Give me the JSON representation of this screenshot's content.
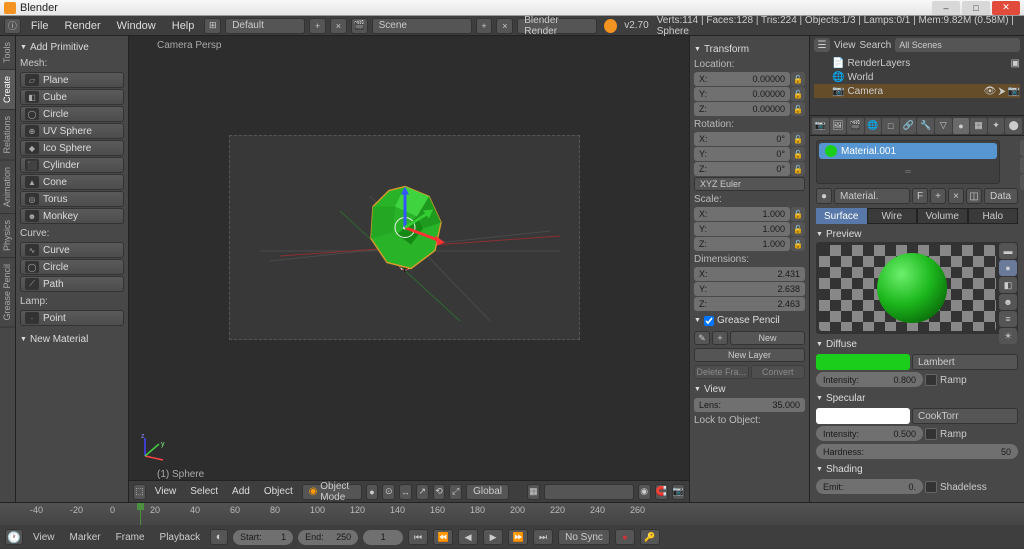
{
  "window": {
    "title": "Blender"
  },
  "winbtn": {
    "min": "–",
    "max": "□",
    "close": "✕"
  },
  "topmenu": {
    "items": [
      "File",
      "Render",
      "Window",
      "Help"
    ],
    "layout": "Default",
    "scene": "Scene",
    "engine": "Blender Render",
    "version": "v2.70",
    "stats": "Verts:114 | Faces:128 | Tris:224 | Objects:1/3 | Lamps:0/1 | Mem:9.82M (0.58M) | Sphere"
  },
  "leftTabs": [
    "Tools",
    "Create",
    "Relations",
    "Animation",
    "Physics",
    "Grease Pencil"
  ],
  "toolshelf": {
    "header": "Add Primitive",
    "mesh_label": "Mesh:",
    "mesh": [
      "Plane",
      "Cube",
      "Circle",
      "UV Sphere",
      "Ico Sphere",
      "Cylinder",
      "Cone",
      "Torus",
      "Monkey"
    ],
    "curve_label": "Curve:",
    "curve": [
      "Curve",
      "Circle",
      "Path"
    ],
    "lamp_label": "Lamp:",
    "lamp": [
      "Point"
    ],
    "op_header": "New Material"
  },
  "viewport": {
    "view_label": "Camera Persp",
    "obj_label": "(1) Sphere",
    "bottom": {
      "menus": [
        "View",
        "Select",
        "Add",
        "Object"
      ],
      "mode": "Object Mode",
      "orient": "Global"
    }
  },
  "npanel": {
    "transform": "Transform",
    "loc_label": "Location:",
    "loc": [
      {
        "a": "X:",
        "v": "0.00000"
      },
      {
        "a": "Y:",
        "v": "0.00000"
      },
      {
        "a": "Z:",
        "v": "0.00000"
      }
    ],
    "rot_label": "Rotation:",
    "rot": [
      {
        "a": "X:",
        "v": "0°"
      },
      {
        "a": "Y:",
        "v": "0°"
      },
      {
        "a": "Z:",
        "v": "0°"
      }
    ],
    "rot_mode": "XYZ Euler",
    "scale_label": "Scale:",
    "scale": [
      {
        "a": "X:",
        "v": "1.000"
      },
      {
        "a": "Y:",
        "v": "1.000"
      },
      {
        "a": "Z:",
        "v": "1.000"
      }
    ],
    "dim_label": "Dimensions:",
    "dim": [
      {
        "a": "X:",
        "v": "2.431"
      },
      {
        "a": "Y:",
        "v": "2.638"
      },
      {
        "a": "Z:",
        "v": "2.463"
      }
    ],
    "gp_header": "Grease Pencil",
    "gp_new": "New",
    "gp_newlayer": "New Layer",
    "gp_delete": "Delete Fra...",
    "gp_convert": "Convert",
    "view_header": "View",
    "lens_label": "Lens:",
    "lens_val": "35.000",
    "lock_label": "Lock to Object:"
  },
  "outliner": {
    "menus": [
      "View",
      "Search"
    ],
    "filter": "All Scenes",
    "items": [
      {
        "icon": "📄",
        "name": "RenderLayers"
      },
      {
        "icon": "🌐",
        "name": "World"
      },
      {
        "icon": "📷",
        "name": "Camera"
      }
    ]
  },
  "props": {
    "crumb1": "Material.",
    "crumb_f": "F",
    "crumb2": "Data",
    "slot_name": "Material.001",
    "tabs": [
      "Surface",
      "Wire",
      "Volume",
      "Halo"
    ],
    "preview_hd": "Preview",
    "diffuse_hd": "Diffuse",
    "diffuse_color": "#1cce1c",
    "diffuse_shader": "Lambert",
    "diffuse_int_lbl": "Intensity:",
    "diffuse_int": "0.800",
    "ramp": "Ramp",
    "spec_hd": "Specular",
    "spec_color": "#ffffff",
    "spec_shader": "CookTorr",
    "spec_int_lbl": "Intensity:",
    "spec_int": "0.500",
    "hard_lbl": "Hardness:",
    "hard": "50",
    "shading_hd": "Shading",
    "emit_lbl": "Emit:",
    "emit": "0.",
    "shadeless": "Shadeless"
  },
  "timeline": {
    "ticks": [
      {
        "p": 30,
        "l": "-40"
      },
      {
        "p": 70,
        "l": "-20"
      },
      {
        "p": 110,
        "l": "0"
      },
      {
        "p": 150,
        "l": "20"
      },
      {
        "p": 190,
        "l": "40"
      },
      {
        "p": 230,
        "l": "60"
      },
      {
        "p": 270,
        "l": "80"
      },
      {
        "p": 310,
        "l": "100"
      },
      {
        "p": 350,
        "l": "120"
      },
      {
        "p": 390,
        "l": "140"
      },
      {
        "p": 430,
        "l": "160"
      },
      {
        "p": 470,
        "l": "180"
      },
      {
        "p": 510,
        "l": "200"
      },
      {
        "p": 550,
        "l": "220"
      },
      {
        "p": 590,
        "l": "240"
      },
      {
        "p": 630,
        "l": "260"
      }
    ],
    "menus": [
      "View",
      "Marker",
      "Frame",
      "Playback"
    ],
    "start_lbl": "Start:",
    "start": "1",
    "end_lbl": "End:",
    "end": "250",
    "cur": "1",
    "sync": "No Sync"
  }
}
